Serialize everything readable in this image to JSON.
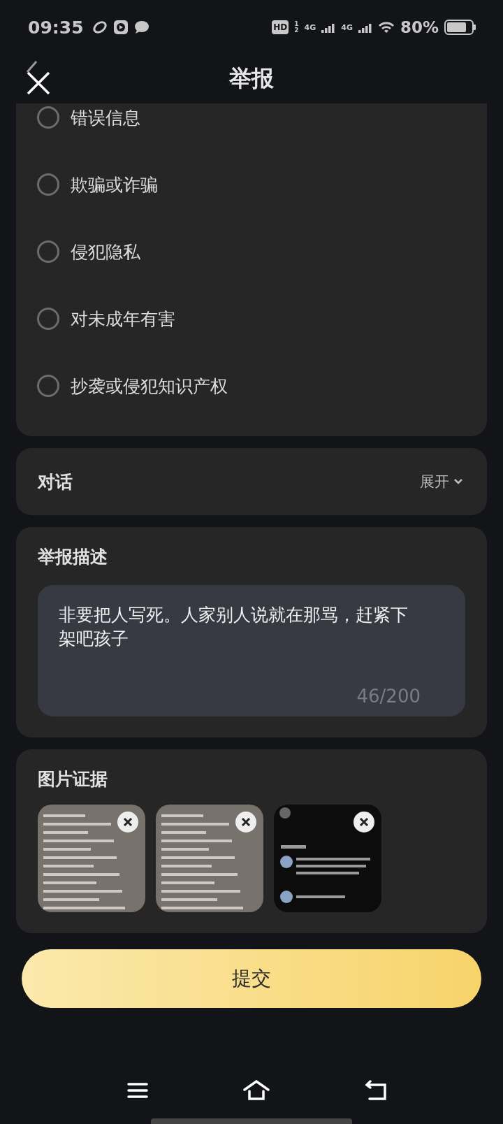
{
  "status_bar": {
    "time": "09:35",
    "hd": "HD",
    "hd_slots": [
      "1",
      "2"
    ],
    "networks": [
      "4G",
      "4G"
    ],
    "battery": "80%"
  },
  "header": {
    "title": "举报"
  },
  "reasons": [
    {
      "label": "错误信息",
      "selected": false
    },
    {
      "label": "欺骗或诈骗",
      "selected": false
    },
    {
      "label": "侵犯隐私",
      "selected": false
    },
    {
      "label": "对未成年有害",
      "selected": false
    },
    {
      "label": "抄袭或侵犯知识产权",
      "selected": false
    }
  ],
  "conversation": {
    "title": "对话",
    "toggle": "展开",
    "expanded": false
  },
  "description": {
    "title": "举报描述",
    "value": "非要把人写死。人家别人说就在那骂，赶紧下架吧孩子",
    "counter": "46/200"
  },
  "evidence": {
    "title": "图片证据"
  },
  "submit": {
    "label": "提交"
  }
}
